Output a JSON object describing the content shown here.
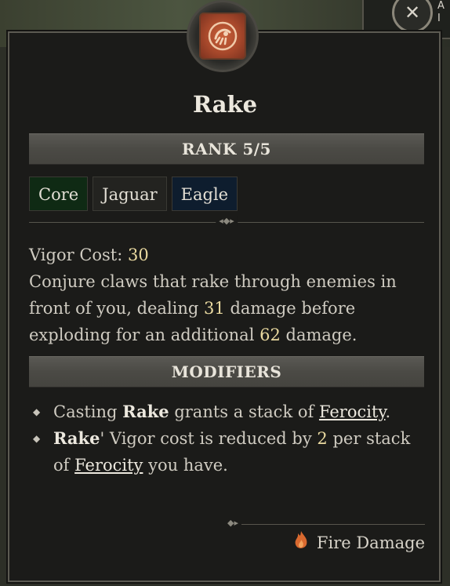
{
  "skill": {
    "name": "Rake",
    "icon": "rake-claw-icon",
    "icon_color": "#b2502f",
    "rank_label": "RANK 5/5",
    "tags": [
      "Core",
      "Jaguar",
      "Eagle"
    ],
    "tag_colors": [
      "#0f2a14",
      "#232320",
      "#0e1d2e"
    ]
  },
  "description": {
    "cost_label": "Vigor Cost:",
    "cost_value": "30",
    "text_1": "Conjure claws that rake through enemies in front of you, dealing",
    "damage_1": "31",
    "text_2": "damage before exploding for an additional",
    "damage_2": "62",
    "text_3": "damage."
  },
  "modifiers": {
    "header": "MODIFIERS",
    "m1_a": "Casting",
    "m1_skill": "Rake",
    "m1_b": "grants a stack of",
    "m1_link": "Ferocity",
    "m1_end": ".",
    "m2_skill": "Rake",
    "m2_a": "' Vigor cost is reduced by",
    "m2_num": "2",
    "m2_b": "per stack of",
    "m2_link": "Ferocity",
    "m2_c": "you have."
  },
  "footer": {
    "damage_type": "Fire Damage",
    "damage_icon": "fire-icon",
    "fire_color": "#d9692f"
  },
  "corner": {
    "icon": "crossed-weapons-icon"
  }
}
